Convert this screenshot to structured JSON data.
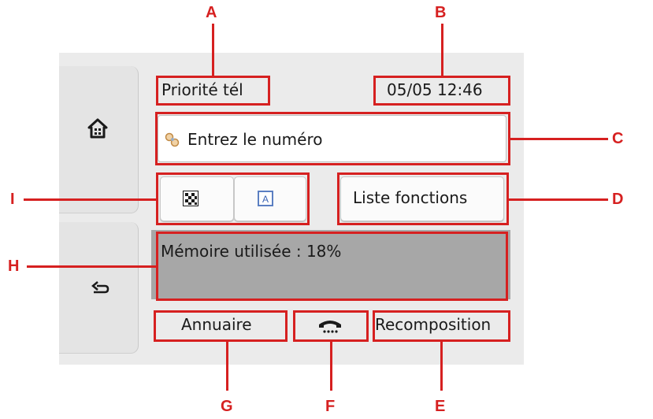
{
  "header": {
    "mode_label": "Priorité tél",
    "datetime": "05/05 12:46"
  },
  "number_field": {
    "placeholder_text": "Entrez le numéro",
    "icon": "phone-keypad-icon"
  },
  "toggles": {
    "resolution_icon": "checkered-resolution-icon",
    "contrast_icon": "contrast-a-icon"
  },
  "function_list_button": "Liste fonctions",
  "memory_status": "Mémoire utilisée : 18%",
  "bottom_bar": {
    "directory_label": "Annuaire",
    "hook_icon": "hook-phone-icon",
    "redial_label": "Recomposition"
  },
  "side_nav": {
    "home_icon": "home-icon",
    "back_icon": "back-arrow-icon"
  },
  "callouts": [
    "A",
    "B",
    "C",
    "D",
    "E",
    "F",
    "G",
    "H",
    "I"
  ],
  "accent_color": "#d62020"
}
